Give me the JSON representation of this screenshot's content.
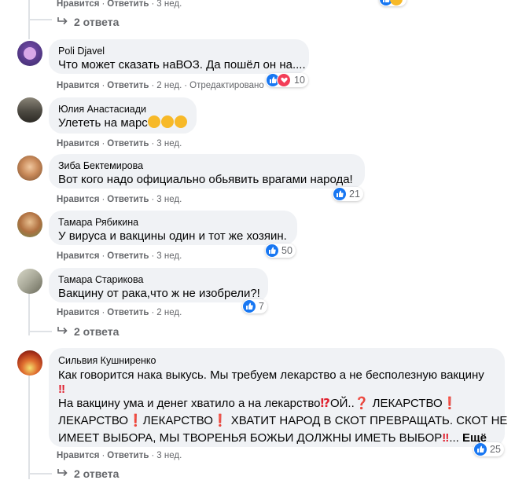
{
  "top": {
    "meta": {
      "like": "Нравится",
      "reply": "Ответить",
      "time": "3 нед."
    },
    "replies": "2 ответа"
  },
  "comments": [
    {
      "author": "Poli Djavel",
      "text": "Что может сказать наВОЗ. Да пошёл он на....",
      "meta": {
        "like": "Нравится",
        "reply": "Ответить",
        "time": "2 нед.",
        "edited": "Отредактировано"
      },
      "reactions": "10"
    },
    {
      "author": "Юлия Анастасиади",
      "text": "Улететь на марс",
      "meta": {
        "like": "Нравится",
        "reply": "Ответить",
        "time": "3 нед."
      }
    },
    {
      "author": "Зиба Бектемирова",
      "text": "Вот кого надо официально обьявить врагами народа!",
      "meta": {
        "like": "Нравится",
        "reply": "Ответить",
        "time": "3 нед."
      },
      "reactions": "21"
    },
    {
      "author": "Тамара Рябикина",
      "text": "У вируса и вакцины один и тот же хозяин.",
      "meta": {
        "like": "Нравится",
        "reply": "Ответить",
        "time": "3 нед."
      },
      "reactions": "50"
    },
    {
      "author": "Тамара Старикова",
      "text": "Вакцину от рака,что ж не изобрели?!",
      "meta": {
        "like": "Нравится",
        "reply": "Ответить",
        "time": "2 нед."
      },
      "reactions": "7",
      "replies": "2 ответа"
    },
    {
      "author": "Сильвия Кушниренко",
      "lines": [
        "Как говорится нака выкусь. Мы требуем лекарство а не бесполезную вакцину",
        "На вакцину ума и денег хватило а на лекарство",
        "ОЙ..",
        "ЛЕКАРСТВО",
        "ЛЕКАРСТВО",
        "ЛЕКАРСТВО",
        "ХВАТИТ НАРОД В СКОТ ПРЕВРАЩАТЬ. СКОТ НЕ",
        "ИМЕЕТ ВЫБОРА, МЫ ТВОРЕНЬЯ БОЖЬИ ДОЛЖНЫ ИМЕТЬ ВЫБОР",
        "...",
        "Ещё"
      ],
      "meta": {
        "like": "Нравится",
        "reply": "Ответить",
        "time": "3 нед."
      },
      "reactions": "25",
      "replies": "2 ответа"
    }
  ],
  "colors": {
    "like_blue": "#1877f2",
    "heart_red": "#f33e58",
    "bubble": "#f0f2f5",
    "meta_gray": "#65676b",
    "bang_red": "#e0202e"
  }
}
